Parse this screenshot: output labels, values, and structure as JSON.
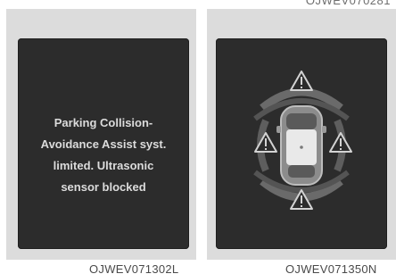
{
  "header": {
    "code": "OJWEV070281"
  },
  "left_panel": {
    "message_lines": [
      "Parking Collision-",
      "Avoidance Assist syst.",
      "limited. Ultrasonic",
      "sensor blocked"
    ],
    "caption": "OJWEV071302L"
  },
  "right_panel": {
    "caption": "OJWEV071350N",
    "warning_icon_count": 4
  },
  "colors": {
    "screen": "#2c2c2c",
    "panel": "#dcdcdc",
    "text": "#dcdcdc",
    "warning": "#cfcfcf"
  }
}
